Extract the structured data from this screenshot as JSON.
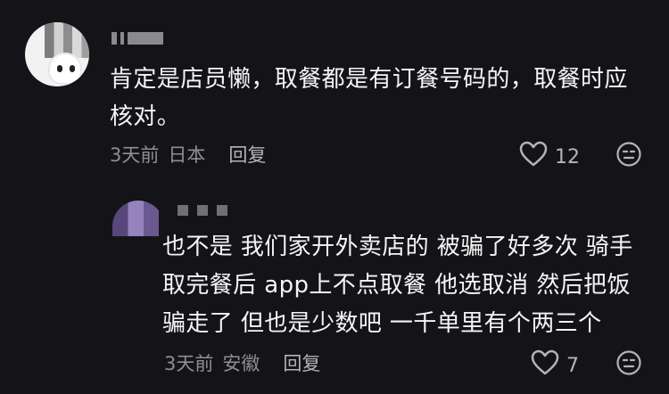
{
  "comments": [
    {
      "text": "肯定是店员懒，取餐都是有订餐号码的，取餐时应核对。",
      "time": "3天前",
      "location": "日本",
      "reply_label": "回复",
      "likes": "12"
    },
    {
      "text": "也不是 我们家开外卖店的 被骗了好多次 骑手取完餐后 app上不点取餐 他选取消 然后把饭骗走了 但也是少数吧 一千单里有个两三个",
      "time": "3天前",
      "location": "安徽",
      "reply_label": "回复",
      "likes": "7"
    }
  ],
  "icons": {
    "like": "heart-outline-icon",
    "emoji": "neutral-face-icon"
  },
  "colors": {
    "background": "#141418",
    "text": "#f5f5f5",
    "meta": "#8e8e93"
  }
}
